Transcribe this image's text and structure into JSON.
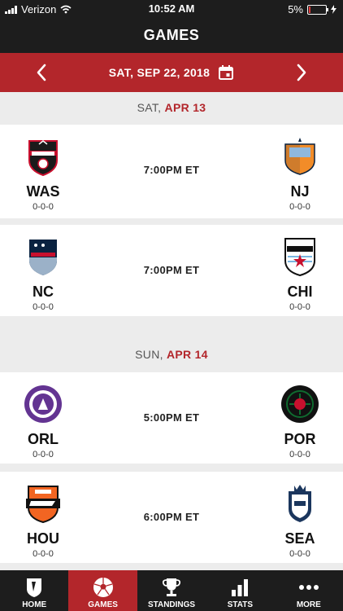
{
  "status_bar": {
    "carrier": "Verizon",
    "time": "10:52 AM",
    "battery": "5%"
  },
  "header": {
    "title": "GAMES"
  },
  "date_nav": {
    "date": "SAT, SEP 22, 2018"
  },
  "days": [
    {
      "day_prefix": "SAT, ",
      "day_date": "APR 13",
      "games": [
        {
          "home": {
            "abbr": "WAS",
            "record": "0-0-0",
            "logo": "spirit-logo"
          },
          "away": {
            "abbr": "NJ",
            "record": "0-0-0",
            "logo": "sky-blue-logo"
          },
          "time": "7:00PM ET"
        },
        {
          "home": {
            "abbr": "NC",
            "record": "0-0-0",
            "logo": "courage-logo"
          },
          "away": {
            "abbr": "CHI",
            "record": "0-0-0",
            "logo": "red-stars-logo"
          },
          "time": "7:00PM ET"
        }
      ]
    },
    {
      "day_prefix": "SUN, ",
      "day_date": "APR 14",
      "games": [
        {
          "home": {
            "abbr": "ORL",
            "record": "0-0-0",
            "logo": "pride-logo"
          },
          "away": {
            "abbr": "POR",
            "record": "0-0-0",
            "logo": "thorns-logo"
          },
          "time": "5:00PM ET"
        },
        {
          "home": {
            "abbr": "HOU",
            "record": "0-0-0",
            "logo": "dash-logo"
          },
          "away": {
            "abbr": "SEA",
            "record": "0-0-0",
            "logo": "reign-logo"
          },
          "time": "6:00PM ET"
        }
      ]
    }
  ],
  "tabs": [
    {
      "label": "HOME",
      "icon": "nwsl-logo-icon",
      "active": false
    },
    {
      "label": "GAMES",
      "icon": "soccer-ball-icon",
      "active": true
    },
    {
      "label": "STANDINGS",
      "icon": "trophy-icon",
      "active": false
    },
    {
      "label": "STATS",
      "icon": "bar-chart-icon",
      "active": false
    },
    {
      "label": "MORE",
      "icon": "more-dots-icon",
      "active": false
    }
  ],
  "colors": {
    "accent": "#b3262b",
    "bar": "#1d1d1d",
    "background": "#ececec"
  }
}
